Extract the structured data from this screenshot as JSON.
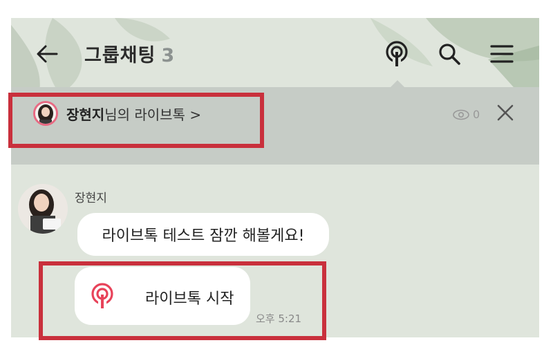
{
  "header": {
    "title": "그룹채팅",
    "member_count": "3",
    "back_icon": "back-arrow-icon",
    "live_icon": "livetalk-icon",
    "search_icon": "search-icon",
    "menu_icon": "menu-icon"
  },
  "livetalk_banner": {
    "host_name": "장현지",
    "suffix": "님의 라이브톡 >",
    "viewer_count": "0",
    "close_icon": "close-icon"
  },
  "messages": [
    {
      "sender": "장현지",
      "text": "라이브톡 테스트 잠깐 해볼게요!"
    },
    {
      "type": "live-start",
      "label": "라이브톡 시작",
      "time": "오후 5:21"
    }
  ],
  "colors": {
    "highlight": "#c9303c",
    "live_accent": "#e8435a",
    "chat_background": "#dfe5dc",
    "banner_background": "#c6ccc6"
  }
}
